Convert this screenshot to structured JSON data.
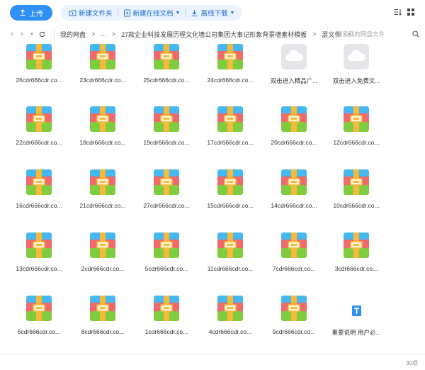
{
  "toolbar": {
    "upload_label": "上传",
    "new_folder_label": "新建文件夹",
    "new_doc_label": "新建在线文档",
    "offline_label": "离线下载"
  },
  "nav": {
    "crumbs": [
      "我的网盘",
      "...",
      "27款企业科技发展历程文化墙公司集团大事记形象背景墙素材模板",
      "源文件"
    ],
    "search_placeholder": "搜索我的网盘文件"
  },
  "colors": {
    "accent": "#2e8ff5",
    "accent_light": "#eaf3fe"
  },
  "files": [
    {
      "name": "26cdr666cdr.co...",
      "icon": "archive-icon"
    },
    {
      "name": "23cdr666cdr.co...",
      "icon": "archive-icon"
    },
    {
      "name": "25cdr666cdr.co...",
      "icon": "archive-icon"
    },
    {
      "name": "24cdr666cdr.co...",
      "icon": "archive-icon"
    },
    {
      "name": "双击进入精品广...",
      "icon": "cloud-icon"
    },
    {
      "name": "双击进入免费文...",
      "icon": "cloud-icon"
    },
    {
      "name": "22cdr666cdr.co...",
      "icon": "archive-icon"
    },
    {
      "name": "18cdr666cdr.co...",
      "icon": "archive-icon"
    },
    {
      "name": "19cdr666cdr.co...",
      "icon": "archive-icon"
    },
    {
      "name": "17cdr666cdr.co...",
      "icon": "archive-icon"
    },
    {
      "name": "20cdr666cdr.co...",
      "icon": "archive-icon"
    },
    {
      "name": "12cdr666cdr.co...",
      "icon": "archive-icon"
    },
    {
      "name": "16cdr666cdr.co...",
      "icon": "archive-icon"
    },
    {
      "name": "21cdr666cdr.co...",
      "icon": "archive-icon"
    },
    {
      "name": "27cdr666cdr.co...",
      "icon": "archive-icon"
    },
    {
      "name": "15cdr666cdr.co...",
      "icon": "archive-icon"
    },
    {
      "name": "14cdr666cdr.co...",
      "icon": "archive-icon"
    },
    {
      "name": "10cdr666cdr.co...",
      "icon": "archive-icon"
    },
    {
      "name": "13cdr666cdr.co...",
      "icon": "archive-icon"
    },
    {
      "name": "2cdr666cdr.co...",
      "icon": "archive-icon"
    },
    {
      "name": "5cdr666cdr.co...",
      "icon": "archive-icon"
    },
    {
      "name": "11cdr666cdr.co...",
      "icon": "archive-icon"
    },
    {
      "name": "7cdr666cdr.co...",
      "icon": "archive-icon"
    },
    {
      "name": "3cdr666cdr.co...",
      "icon": "archive-icon"
    },
    {
      "name": "6cdr666cdr.co...",
      "icon": "archive-icon"
    },
    {
      "name": "8cdr666cdr.co...",
      "icon": "archive-icon"
    },
    {
      "name": "1cdr666cdr.co...",
      "icon": "archive-icon"
    },
    {
      "name": "4cdr666cdr.co...",
      "icon": "archive-icon"
    },
    {
      "name": "9cdr666cdr.co...",
      "icon": "archive-icon"
    },
    {
      "name": "重要说明 用户必...",
      "icon": "doc-icon"
    }
  ],
  "status": {
    "count": "30项"
  }
}
